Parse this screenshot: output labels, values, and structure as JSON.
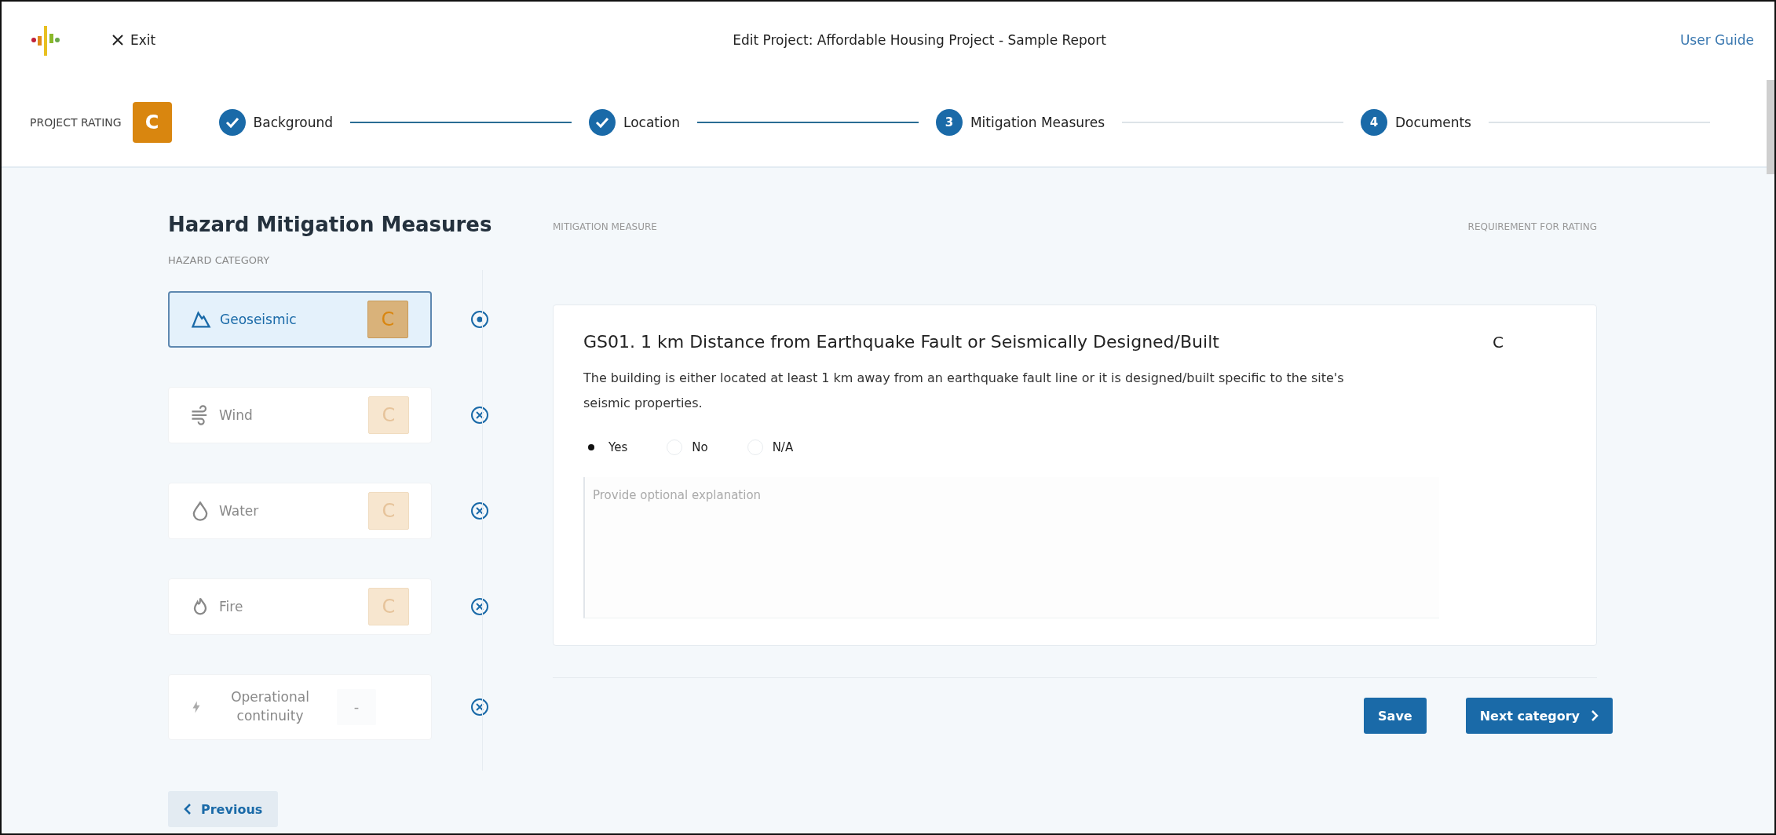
{
  "header": {
    "exit_label": "Exit",
    "title": "Edit Project: Affordable Housing Project - Sample Report",
    "user_guide": "User Guide"
  },
  "rating": {
    "label": "PROJECT RATING",
    "value": "C"
  },
  "steps": [
    {
      "label": "Background",
      "kind": "done"
    },
    {
      "label": "Location",
      "kind": "done"
    },
    {
      "label": "Mitigation Measures",
      "number": "3",
      "kind": "pending"
    },
    {
      "label": "Documents",
      "number": "4",
      "kind": "pending"
    }
  ],
  "sidebar": {
    "title": "Hazard Mitigation Measures",
    "subtitle": "HAZARD CATEGORY",
    "categories": [
      {
        "label": "Geoseismic",
        "kind": "geoseismic",
        "rating": "C",
        "selected": true
      },
      {
        "label": "Wind",
        "kind": "wind",
        "rating": "C",
        "selected": false
      },
      {
        "label": "Water",
        "kind": "water",
        "rating": "C",
        "selected": false
      },
      {
        "label": "Fire",
        "kind": "fire",
        "rating": "C",
        "selected": false
      },
      {
        "label": "Operational continuity",
        "kind": "power",
        "rating": "-",
        "selected": false
      }
    ]
  },
  "columns": {
    "measure": "MITIGATION MEASURE",
    "requirement": "REQUIREMENT FOR RATING"
  },
  "measure": {
    "title": "GS01. 1 km Distance from Earthquake Fault or Seismically Designed/Built",
    "requirement": "C",
    "description": "The building is either located at least 1 km away from an earthquake fault line or it is designed/built specific to the site's seismic properties.",
    "options": [
      {
        "label": "Yes",
        "selected": true
      },
      {
        "label": "No",
        "selected": false
      },
      {
        "label": "N/A",
        "selected": false
      }
    ],
    "explanation": {
      "placeholder": "Provide optional explanation"
    }
  },
  "buttons": {
    "previous": "Previous",
    "save": "Save",
    "next": "Next category"
  }
}
